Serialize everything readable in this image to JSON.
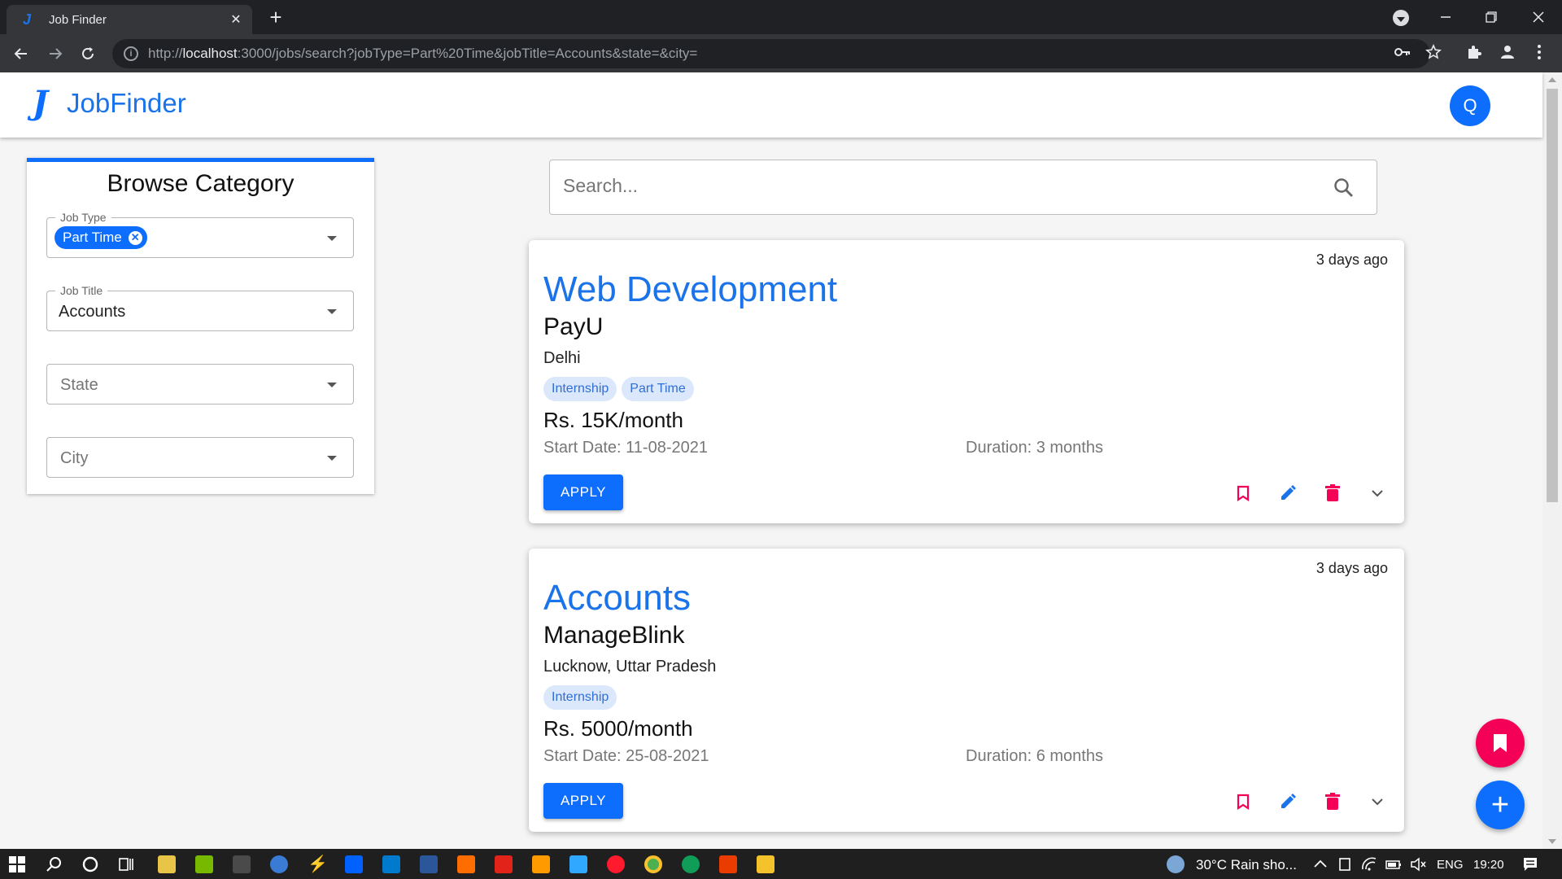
{
  "browser": {
    "tab_title": "Job Finder",
    "url_prefix": "http://",
    "url_host": "localhost",
    "url_rest": ":3000/jobs/search?jobType=Part%20Time&jobTitle=Accounts&state=&city="
  },
  "app": {
    "name": "JobFinder",
    "avatar_letter": "Q",
    "accent_color": "#0d6efd",
    "danger_color": "#f50057"
  },
  "sidebar": {
    "title": "Browse Category",
    "job_type": {
      "label": "Job Type",
      "selected_chip": "Part Time"
    },
    "job_title": {
      "label": "Job Title",
      "value": "Accounts"
    },
    "state": {
      "placeholder": "State"
    },
    "city": {
      "placeholder": "City"
    }
  },
  "search": {
    "placeholder": "Search..."
  },
  "jobs": [
    {
      "posted": "3 days ago",
      "title": "Web Development",
      "company": "PayU",
      "location": "Delhi",
      "tags": [
        "Internship",
        "Part Time"
      ],
      "salary": "Rs. 15K/month",
      "start_date": "Start Date: 11-08-2021",
      "duration": "Duration: 3 months",
      "apply_label": "APPLY"
    },
    {
      "posted": "3 days ago",
      "title": "Accounts",
      "company": "ManageBlink",
      "location": "Lucknow, Uttar Pradesh",
      "tags": [
        "Internship"
      ],
      "salary": "Rs. 5000/month",
      "start_date": "Start Date: 25-08-2021",
      "duration": "Duration: 6 months",
      "apply_label": "APPLY"
    }
  ],
  "taskbar": {
    "weather": "30°C  Rain sho...",
    "language": "ENG",
    "time": "19:20"
  }
}
